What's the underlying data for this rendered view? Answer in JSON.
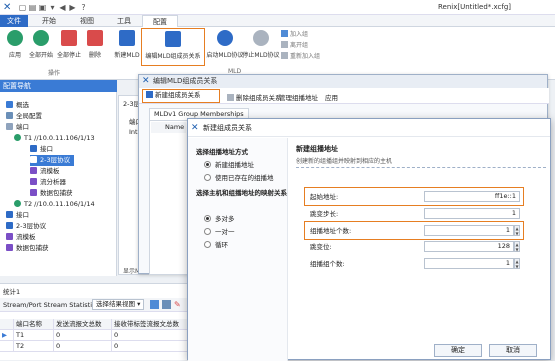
{
  "window": {
    "title": "Renix[Untitled*.xcfg]"
  },
  "menu": {
    "file": "文件",
    "start": "开始",
    "view": "视图",
    "tools": "工具",
    "config": "配置"
  },
  "ribbon": {
    "apply": "应用",
    "start_all": "全部开始",
    "stop_all": "全部停止",
    "delete": "删除",
    "new_mld": "新建MLD",
    "edit_mld_member": "编辑MLD组成员关系",
    "start_mld": "启动MLD协议",
    "stop_mld": "停止MLD协议",
    "join_group": "加入组",
    "leave_group": "离开组",
    "rejoin_group": "重新加入组",
    "group_ops": "操作",
    "group_mld": "MLD"
  },
  "nav": {
    "header": "配置导航",
    "items": [
      "概选",
      "全局配置",
      "端口",
      "T1 //10.0.11.106/1/13",
      "接口",
      "2-3层协议",
      "流模板",
      "流分析器",
      "数据包捕获",
      "T2 //10.0.11.106/1/14",
      "接口",
      "2-3层协议",
      "流模板",
      "数据包捕获"
    ]
  },
  "center": {
    "tab_label": "2-3层协",
    "col_port": "端口",
    "col_interface": "Interfa",
    "footer": "显示MLDv1"
  },
  "stats": {
    "title": "统计1",
    "tab": "Stream/Port Stream Statistic",
    "select_view": "选择结果视图",
    "columns": [
      "端口名称",
      "发送流报文总数",
      "接收带标签流报文总数"
    ],
    "rows": [
      {
        "port": "T1",
        "tx": "0",
        "rx": "0"
      },
      {
        "port": "T2",
        "tx": "0",
        "rx": "0"
      }
    ]
  },
  "dialog1": {
    "title": "编辑MLD组成员关系",
    "toolbar": {
      "new": "新建组成员关系",
      "delete": "删除组成员关系",
      "manage": "管理组播地址",
      "apply": "应用"
    },
    "tab": "MLDv1 Group Memberships",
    "col_name": "Name"
  },
  "dialog2": {
    "title": "新建组成员关系",
    "section1": "选择组播地址方式",
    "opt_new": "新建组播地址",
    "opt_existing": "使用已存在的组播地",
    "section2": "选择主机和组播地址的映射关系",
    "opt_many": "多对多",
    "opt_one": "一对一",
    "opt_loop": "循环",
    "right_title": "新建组播地址",
    "right_desc": "创建新的组播组并映射到相应的主机",
    "fields": [
      {
        "label": "起始地址:",
        "value": "ff1e::1"
      },
      {
        "label": "跳变步长:",
        "value": "1"
      },
      {
        "label": "组播地址个数:",
        "value": "1"
      },
      {
        "label": "跳变位:",
        "value": "128"
      },
      {
        "label": "组播组个数:",
        "value": "1"
      }
    ],
    "ok": "确定",
    "cancel": "取消"
  }
}
